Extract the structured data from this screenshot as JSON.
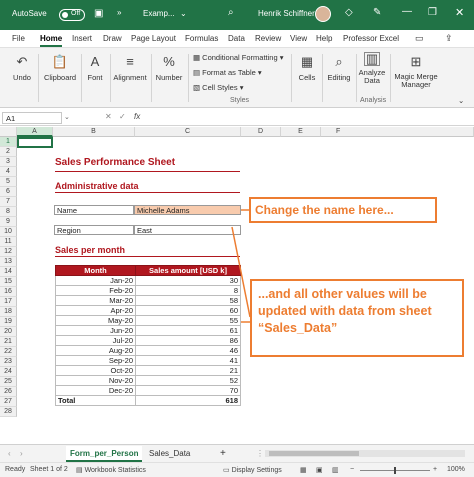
{
  "titlebar": {
    "autosave": "AutoSave",
    "toggle_state": "Off",
    "filename": "Examp...",
    "user": "Henrik Schiffner"
  },
  "menu": [
    "File",
    "Home",
    "Insert",
    "Draw",
    "Page Layout",
    "Formulas",
    "Data",
    "Review",
    "View",
    "Help",
    "Professor Excel"
  ],
  "ribbon": {
    "undo": "Undo",
    "clipboard": "Clipboard",
    "font": "Font",
    "alignment": "Alignment",
    "number": "Number",
    "conditional_formatting": "Conditional Formatting",
    "format_as_table": "Format as Table",
    "cell_styles": "Cell Styles",
    "styles_group": "Styles",
    "cells": "Cells",
    "editing": "Editing",
    "analyze": "Analyze",
    "analyze_data": "Data",
    "analysis_group": "Analysis",
    "magic_merge": "Magic Merge",
    "manager": "Manager"
  },
  "formula_bar": {
    "cell_ref": "A1",
    "fx": "fx",
    "value": ""
  },
  "columns": [
    "A",
    "B",
    "C",
    "D",
    "E",
    "F"
  ],
  "rows": [
    "1",
    "2",
    "3",
    "4",
    "5",
    "6",
    "7",
    "8",
    "9",
    "10",
    "11",
    "12",
    "13",
    "14",
    "15",
    "16",
    "17",
    "18",
    "19",
    "20",
    "21",
    "22",
    "23",
    "24",
    "25",
    "26",
    "27",
    "28"
  ],
  "sheet": {
    "title": "Sales Performance Sheet",
    "admin_header": "Administrative data",
    "name_label": "Name",
    "name_value": "Michelle Adams",
    "region_label": "Region",
    "region_value": "East",
    "sales_header": "Sales per month",
    "table_headers": [
      "Month",
      "Sales amount [USD k]"
    ],
    "table_rows": [
      [
        "Jan-20",
        "30"
      ],
      [
        "Feb-20",
        "8"
      ],
      [
        "Mar-20",
        "58"
      ],
      [
        "Apr-20",
        "60"
      ],
      [
        "May-20",
        "55"
      ],
      [
        "Jun-20",
        "61"
      ],
      [
        "Jul-20",
        "86"
      ],
      [
        "Aug-20",
        "46"
      ],
      [
        "Sep-20",
        "41"
      ],
      [
        "Oct-20",
        "21"
      ],
      [
        "Nov-20",
        "52"
      ],
      [
        "Dec-20",
        "70"
      ]
    ],
    "total_label": "Total",
    "total_value": "618"
  },
  "callouts": {
    "one": "Change the name here...",
    "two": "...and all other values will be updated with data from sheet “Sales_Data”"
  },
  "tabs": {
    "active": "Form_per_Person",
    "other": "Sales_Data",
    "add": "+"
  },
  "status": {
    "ready": "Ready",
    "sheet": "Sheet 1 of 2",
    "stats": "Workbook Statistics",
    "display": "Display Settings",
    "zoom": "100%"
  },
  "colors": {
    "excel_green": "#217346",
    "accent_red": "#b0171f",
    "callout_orange": "#ed7d31",
    "name_fill": "#f8cbad"
  }
}
